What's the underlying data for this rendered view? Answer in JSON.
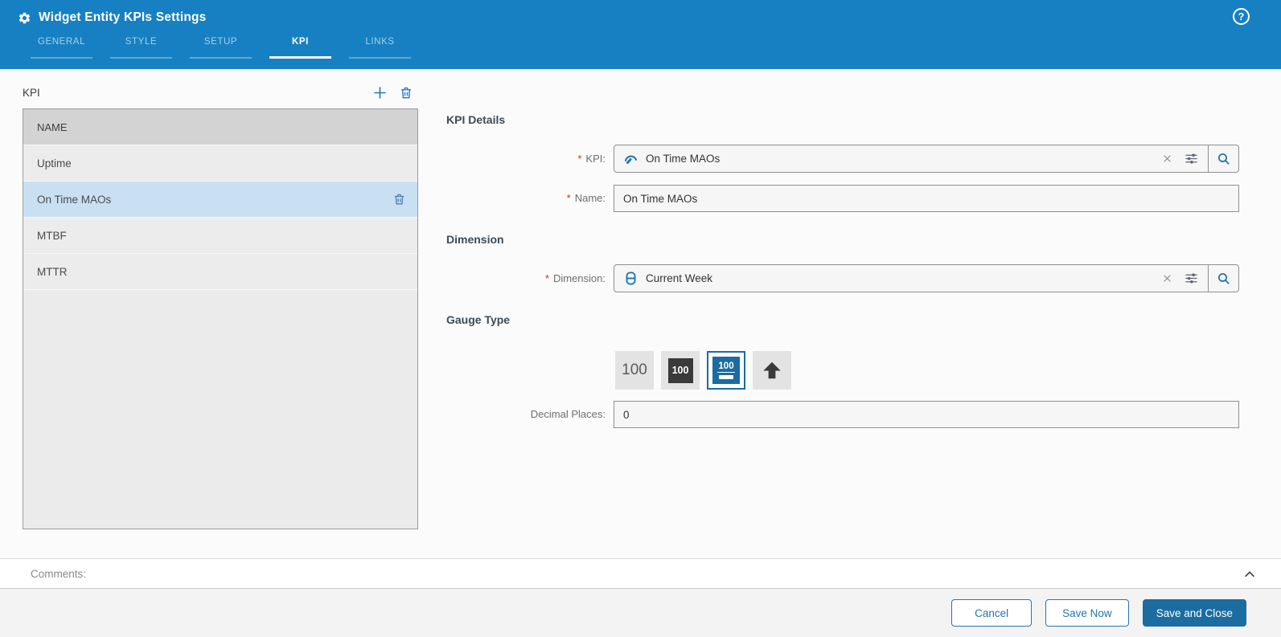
{
  "header": {
    "title": "Widget Entity KPIs Settings",
    "tabs": [
      {
        "label": "GENERAL",
        "active": false
      },
      {
        "label": "STYLE",
        "active": false
      },
      {
        "label": "SETUP",
        "active": false
      },
      {
        "label": "KPI",
        "active": true
      },
      {
        "label": "LINKS",
        "active": false
      }
    ],
    "help_glyph": "?"
  },
  "kpi_list": {
    "title": "KPI",
    "columns": [
      "NAME"
    ],
    "rows": [
      {
        "name": "Uptime",
        "selected": false
      },
      {
        "name": "On Time MAOs",
        "selected": true
      },
      {
        "name": "MTBF",
        "selected": false
      },
      {
        "name": "MTTR",
        "selected": false
      }
    ]
  },
  "details": {
    "section_kpi_heading": "KPI Details",
    "kpi_label": "KPI:",
    "kpi_value": "On Time MAOs",
    "name_label": "Name:",
    "name_value": "On Time MAOs",
    "section_dimension_heading": "Dimension",
    "dimension_label": "Dimension:",
    "dimension_value": "Current Week",
    "section_gauge_heading": "Gauge Type",
    "gauge_options": [
      {
        "name": "number-plain",
        "label": "100",
        "selected": false
      },
      {
        "name": "number-dark-box",
        "label": "100",
        "selected": false
      },
      {
        "name": "number-with-bar",
        "label": "100",
        "selected": true
      },
      {
        "name": "trend-arrow",
        "label": "",
        "selected": false
      }
    ],
    "decimal_label": "Decimal Places:",
    "decimal_value": "0"
  },
  "comments": {
    "label": "Comments:"
  },
  "footer": {
    "cancel_label": "Cancel",
    "save_now_label": "Save Now",
    "save_close_label": "Save and Close"
  },
  "icons": {
    "header": "gear-icon",
    "help": "question-circle-icon",
    "add": "plus-icon",
    "delete": "trash-icon",
    "kpi_field": "gauge-icon",
    "dimension_field": "database-icon",
    "clear": "x-icon",
    "options": "sliders-icon",
    "search": "magnifier-icon",
    "gauge_arrow": "arrow-up-icon",
    "collapse": "chevron-up-icon"
  },
  "colors": {
    "header_bg": "#1680c2",
    "accent": "#2575b2",
    "primary_button": "#1b6ca1",
    "selected_row": "#c9e0f2",
    "required_asterisk": "#c0392b"
  }
}
